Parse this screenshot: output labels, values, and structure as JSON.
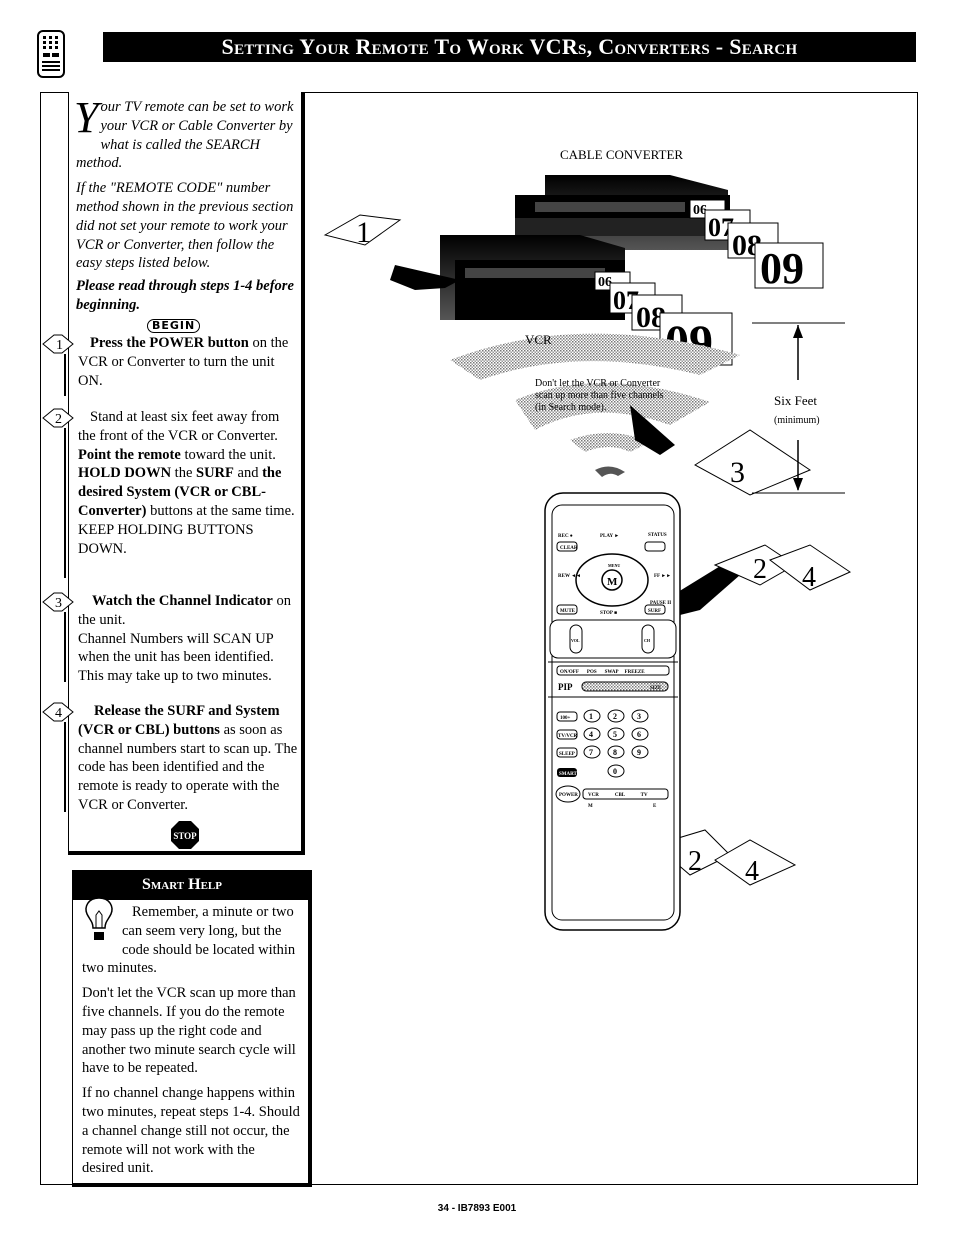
{
  "header": {
    "title": "Setting Your Remote To Work VCRs, Converters - Search",
    "icon": "remote-control-icon"
  },
  "intro": {
    "dropcap": "Y",
    "p1": "our TV remote can be set to work your VCR or Cable Converter by what is called the SEARCH method.",
    "p2": "If the \"REMOTE CODE\" number method shown in the previous section did not set your remote to work your VCR or Converter, then follow the easy steps listed below.",
    "p3": "Please read through steps 1-4 before beginning."
  },
  "begin_label": "BEGIN",
  "steps": [
    {
      "num": "1",
      "bold": "Press the POWER button",
      "text": " on the VCR or Converter to turn the unit ON."
    },
    {
      "num": "2",
      "html_parts": [
        "Stand at least six feet away from the front of the VCR or Converter.",
        "Point the remote",
        " toward the unit. ",
        "HOLD DOWN",
        " the ",
        "SURF",
        " and ",
        "the desired System (VCR or CBL-Converter)",
        " buttons at the same time. KEEP HOLDING BUTTONS DOWN."
      ]
    },
    {
      "num": "3",
      "bold": "Watch the Channel Indicator",
      "text": " on the unit.",
      "text2": "Channel Numbers will SCAN UP when the unit has been identified. This may take up to two minutes."
    },
    {
      "num": "4",
      "bold": "Release the SURF and System (VCR or CBL) buttons",
      "text": " as soon as channel numbers start to scan up.  The code has been identified and the remote is ready to operate with the VCR or Converter."
    }
  ],
  "stop_label": "STOP",
  "smart_help": {
    "title": "Smart Help",
    "p1": "Remember, a minute or two can seem very long, but the code should be located within two minutes.",
    "p2": "Don't let the VCR scan up more than five channels. If you do the remote may pass up the right code and another two minute search cycle will have to be repeated.",
    "p3": "If no channel change happens within two minutes, repeat steps 1-4.  Should a channel change still not occur, the remote will not work with the desired unit."
  },
  "illustration": {
    "cable_converter_label": "CABLE CONVERTER",
    "vcr_label": "VCR",
    "warning": [
      "Don't let the VCR or Converter",
      "scan up more than five channels",
      "(in Search mode)."
    ],
    "six_feet": "Six Feet",
    "minimum": "(minimum)",
    "channels": [
      "06",
      "07",
      "08",
      "09"
    ],
    "step_markers": [
      "1",
      "3",
      "2",
      "4",
      "2",
      "4"
    ],
    "remote_buttons": {
      "rec": "REC ●",
      "clear": "CLEAR",
      "play": "PLAY ►",
      "status": "STATUS",
      "rew": "REW ◄◄",
      "ff": "FF ►►",
      "menu": "MENU",
      "m": "M",
      "pause": "PAUSE II",
      "mute": "MUTE",
      "stop": "STOP ■",
      "surf": "SURF",
      "vol": "VOL",
      "ch": "CH",
      "pip_row": [
        "ON/OFF",
        "POS",
        "SWAP",
        "FREEZE"
      ],
      "pip": "PIP",
      "size": "SIZE",
      "hundred": "100+",
      "tvvcr": "TV/VCR",
      "sleep": "SLEEP",
      "smart": "SMART",
      "power": "POWER",
      "digits": [
        "1",
        "2",
        "3",
        "4",
        "5",
        "6",
        "7",
        "8",
        "9",
        "0"
      ],
      "system": [
        "VCR",
        "CBL",
        "TV"
      ],
      "m_label": "M",
      "e_label": "E"
    }
  },
  "footer": "34 - IB7893 E001"
}
